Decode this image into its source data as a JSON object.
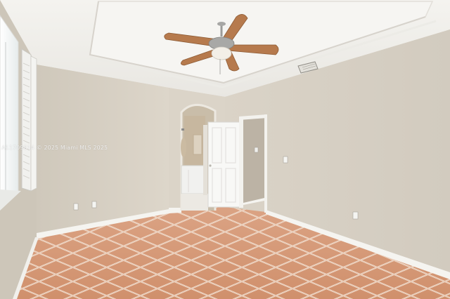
{
  "photo": {
    "subject": "empty-bedroom-interior",
    "watermark": "A11709814 © 2025 Miami MLS 2025"
  },
  "colors": {
    "wall": "#d8d1c5",
    "wall_right": "#d4cdc1",
    "ceiling": "#f1f0ec",
    "floor": "#d89a78",
    "baseboard": "#f4f3ef",
    "door": "#f7f7f5",
    "fan_blade": "#b67a4d"
  }
}
